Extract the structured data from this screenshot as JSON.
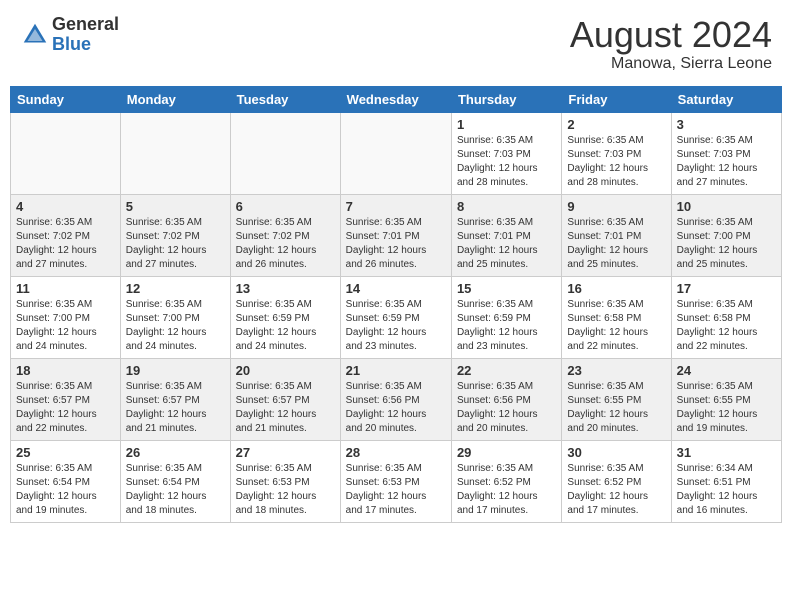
{
  "header": {
    "logo_general": "General",
    "logo_blue": "Blue",
    "month_title": "August 2024",
    "location": "Manowa, Sierra Leone"
  },
  "days_of_week": [
    "Sunday",
    "Monday",
    "Tuesday",
    "Wednesday",
    "Thursday",
    "Friday",
    "Saturday"
  ],
  "weeks": [
    {
      "days": [
        {
          "num": "",
          "info": ""
        },
        {
          "num": "",
          "info": ""
        },
        {
          "num": "",
          "info": ""
        },
        {
          "num": "",
          "info": ""
        },
        {
          "num": "1",
          "info": "Sunrise: 6:35 AM\nSunset: 7:03 PM\nDaylight: 12 hours\nand 28 minutes."
        },
        {
          "num": "2",
          "info": "Sunrise: 6:35 AM\nSunset: 7:03 PM\nDaylight: 12 hours\nand 28 minutes."
        },
        {
          "num": "3",
          "info": "Sunrise: 6:35 AM\nSunset: 7:03 PM\nDaylight: 12 hours\nand 27 minutes."
        }
      ]
    },
    {
      "days": [
        {
          "num": "4",
          "info": "Sunrise: 6:35 AM\nSunset: 7:02 PM\nDaylight: 12 hours\nand 27 minutes."
        },
        {
          "num": "5",
          "info": "Sunrise: 6:35 AM\nSunset: 7:02 PM\nDaylight: 12 hours\nand 27 minutes."
        },
        {
          "num": "6",
          "info": "Sunrise: 6:35 AM\nSunset: 7:02 PM\nDaylight: 12 hours\nand 26 minutes."
        },
        {
          "num": "7",
          "info": "Sunrise: 6:35 AM\nSunset: 7:01 PM\nDaylight: 12 hours\nand 26 minutes."
        },
        {
          "num": "8",
          "info": "Sunrise: 6:35 AM\nSunset: 7:01 PM\nDaylight: 12 hours\nand 25 minutes."
        },
        {
          "num": "9",
          "info": "Sunrise: 6:35 AM\nSunset: 7:01 PM\nDaylight: 12 hours\nand 25 minutes."
        },
        {
          "num": "10",
          "info": "Sunrise: 6:35 AM\nSunset: 7:00 PM\nDaylight: 12 hours\nand 25 minutes."
        }
      ]
    },
    {
      "days": [
        {
          "num": "11",
          "info": "Sunrise: 6:35 AM\nSunset: 7:00 PM\nDaylight: 12 hours\nand 24 minutes."
        },
        {
          "num": "12",
          "info": "Sunrise: 6:35 AM\nSunset: 7:00 PM\nDaylight: 12 hours\nand 24 minutes."
        },
        {
          "num": "13",
          "info": "Sunrise: 6:35 AM\nSunset: 6:59 PM\nDaylight: 12 hours\nand 24 minutes."
        },
        {
          "num": "14",
          "info": "Sunrise: 6:35 AM\nSunset: 6:59 PM\nDaylight: 12 hours\nand 23 minutes."
        },
        {
          "num": "15",
          "info": "Sunrise: 6:35 AM\nSunset: 6:59 PM\nDaylight: 12 hours\nand 23 minutes."
        },
        {
          "num": "16",
          "info": "Sunrise: 6:35 AM\nSunset: 6:58 PM\nDaylight: 12 hours\nand 22 minutes."
        },
        {
          "num": "17",
          "info": "Sunrise: 6:35 AM\nSunset: 6:58 PM\nDaylight: 12 hours\nand 22 minutes."
        }
      ]
    },
    {
      "days": [
        {
          "num": "18",
          "info": "Sunrise: 6:35 AM\nSunset: 6:57 PM\nDaylight: 12 hours\nand 22 minutes."
        },
        {
          "num": "19",
          "info": "Sunrise: 6:35 AM\nSunset: 6:57 PM\nDaylight: 12 hours\nand 21 minutes."
        },
        {
          "num": "20",
          "info": "Sunrise: 6:35 AM\nSunset: 6:57 PM\nDaylight: 12 hours\nand 21 minutes."
        },
        {
          "num": "21",
          "info": "Sunrise: 6:35 AM\nSunset: 6:56 PM\nDaylight: 12 hours\nand 20 minutes."
        },
        {
          "num": "22",
          "info": "Sunrise: 6:35 AM\nSunset: 6:56 PM\nDaylight: 12 hours\nand 20 minutes."
        },
        {
          "num": "23",
          "info": "Sunrise: 6:35 AM\nSunset: 6:55 PM\nDaylight: 12 hours\nand 20 minutes."
        },
        {
          "num": "24",
          "info": "Sunrise: 6:35 AM\nSunset: 6:55 PM\nDaylight: 12 hours\nand 19 minutes."
        }
      ]
    },
    {
      "days": [
        {
          "num": "25",
          "info": "Sunrise: 6:35 AM\nSunset: 6:54 PM\nDaylight: 12 hours\nand 19 minutes."
        },
        {
          "num": "26",
          "info": "Sunrise: 6:35 AM\nSunset: 6:54 PM\nDaylight: 12 hours\nand 18 minutes."
        },
        {
          "num": "27",
          "info": "Sunrise: 6:35 AM\nSunset: 6:53 PM\nDaylight: 12 hours\nand 18 minutes."
        },
        {
          "num": "28",
          "info": "Sunrise: 6:35 AM\nSunset: 6:53 PM\nDaylight: 12 hours\nand 17 minutes."
        },
        {
          "num": "29",
          "info": "Sunrise: 6:35 AM\nSunset: 6:52 PM\nDaylight: 12 hours\nand 17 minutes."
        },
        {
          "num": "30",
          "info": "Sunrise: 6:35 AM\nSunset: 6:52 PM\nDaylight: 12 hours\nand 17 minutes."
        },
        {
          "num": "31",
          "info": "Sunrise: 6:34 AM\nSunset: 6:51 PM\nDaylight: 12 hours\nand 16 minutes."
        }
      ]
    }
  ]
}
